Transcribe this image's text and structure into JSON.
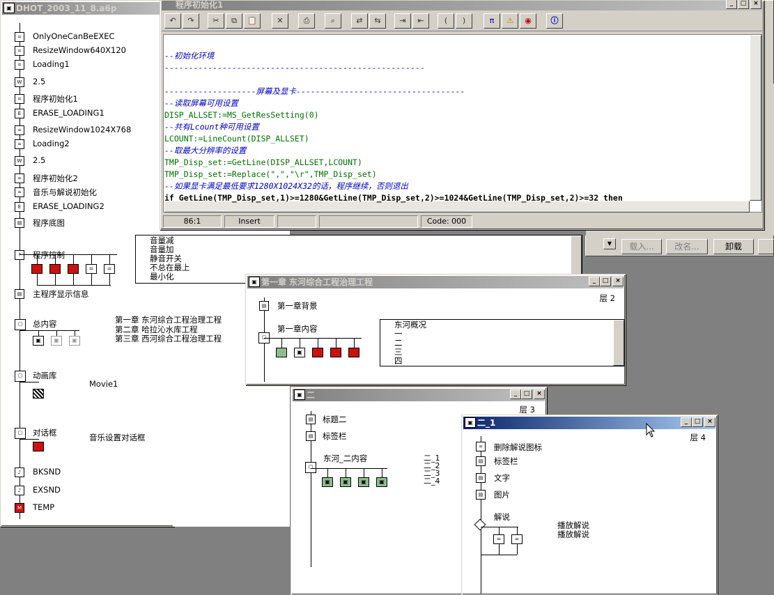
{
  "main_window": {
    "title": "DHOT_2003_11_8.a6p"
  },
  "main_flow": [
    {
      "label": "OnlyOneCanBeEXEC",
      "icon": "calc-icon"
    },
    {
      "label": "ResizeWindow640X120",
      "icon": "calc-icon"
    },
    {
      "label": "Loading1",
      "icon": "calc-icon"
    },
    {
      "label": "2.5",
      "icon": "wait-icon"
    },
    {
      "label": "程序初始化1",
      "icon": "calc-icon"
    },
    {
      "label": "ERASE_LOADING1",
      "icon": "erase-icon"
    },
    {
      "label": "ResizeWindow1024X768",
      "icon": "calc-icon"
    },
    {
      "label": "Loading2",
      "icon": "calc-icon"
    },
    {
      "label": "2.5",
      "icon": "wait-icon"
    },
    {
      "label": "程序初始化2",
      "icon": "calc-icon"
    },
    {
      "label": "音乐与解说初始化",
      "icon": "calc-icon"
    },
    {
      "label": "ERASE_LOADING2",
      "icon": "erase-icon"
    },
    {
      "label": "程序底图",
      "icon": "display-icon"
    },
    {
      "label": "程序控制",
      "icon": "decision-icon"
    },
    {
      "label": "主程序显示信息",
      "icon": "display-icon"
    },
    {
      "label": "总内容",
      "icon": "framework-icon"
    },
    {
      "label": "动画库",
      "icon": "framework-icon"
    },
    {
      "label": "对话框",
      "icon": "framework-icon"
    },
    {
      "label": "BKSND",
      "icon": "sound-icon"
    },
    {
      "label": "EXSND",
      "icon": "sound-icon"
    },
    {
      "label": "TEMP",
      "icon": "map-icon"
    }
  ],
  "side_labels": {
    "movie": "Movie1",
    "dialog": "音乐设置对话框"
  },
  "chapters": [
    "第一章 东河综合工程治理工程",
    "第二章 哈拉沁水库工程",
    "第三章 西河综合工程治理工程"
  ],
  "control_list": [
    "音量减",
    "音量加",
    "静音开关",
    "不总在最上",
    "最小化"
  ],
  "code_editor": {
    "title": "程序初始化1",
    "status": {
      "position": "86:1",
      "mode": "Insert",
      "code": "Code: 000"
    },
    "lines": [
      "",
      "--初始化环境",
      "------------------------------------------------------",
      "",
      "-------------------屏幕及显卡-----------------------------------",
      "--读取屏幕可用设置",
      "DISP_ALLSET:=MS_GetResSetting(0)",
      "--共有Lcount种可用设置",
      "LCOUNT:=LineCount(DISP_ALLSET)",
      "--取最大分辨率的设置",
      "TMP_Disp_set:=GetLine(DISP_ALLSET,LCOUNT)",
      "TMP_Disp_set:=Replace(\",\",\"\\r\",TMP_Disp_set)",
      "--如果显卡满足最低要求1280X1024X32的话，程序继续，否则退出",
      "if GetLine(TMP_Disp_set,1)>=1280&GetLine(TMP_Disp_set,2)>=1024&GetLine(TMP_Disp_set,2)>=32 then"
    ]
  },
  "bg_buttons": {
    "load": "载入...",
    "rename": "改名...",
    "unload": "卸载"
  },
  "ch1_window": {
    "title": "第一章 东河综合工程治理工程",
    "level": "层 2",
    "items": [
      "第一章背景",
      "第一章内容"
    ],
    "list": [
      "东河概况",
      "一",
      "二",
      "三",
      "四"
    ]
  },
  "sub2_window": {
    "title": "二",
    "level": "层 3",
    "items": [
      "标题二",
      "标签栏",
      "东河_二内容"
    ],
    "sublabels": [
      "二_1",
      "二_2",
      "二_3",
      "二_4"
    ]
  },
  "sub21_window": {
    "title": "二_1",
    "level": "层 4",
    "items": [
      "删除解说图标",
      "标签栏",
      "文字",
      "图片",
      "解说"
    ],
    "notes": [
      "播放解说",
      "播放解说"
    ]
  }
}
